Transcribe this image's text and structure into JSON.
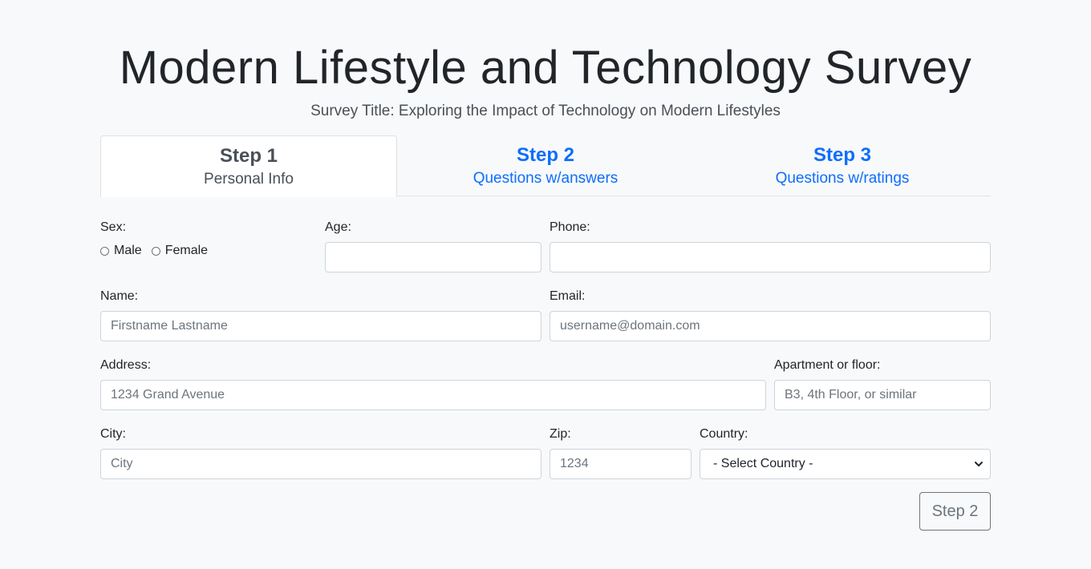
{
  "header": {
    "title": "Modern Lifestyle and Technology Survey",
    "subtitle": "Survey Title: Exploring the Impact of Technology on Modern Lifestyles"
  },
  "tabs": [
    {
      "step": "Step 1",
      "label": "Personal Info",
      "active": true
    },
    {
      "step": "Step 2",
      "label": "Questions w/answers",
      "active": false
    },
    {
      "step": "Step 3",
      "label": "Questions w/ratings",
      "active": false
    }
  ],
  "form": {
    "sex": {
      "label": "Sex:",
      "options": [
        "Male",
        "Female"
      ]
    },
    "age": {
      "label": "Age:",
      "value": "",
      "placeholder": ""
    },
    "phone": {
      "label": "Phone:",
      "value": "",
      "placeholder": ""
    },
    "name": {
      "label": "Name:",
      "placeholder": "Firstname Lastname"
    },
    "email": {
      "label": "Email:",
      "placeholder": "username@domain.com"
    },
    "address": {
      "label": "Address:",
      "placeholder": "1234 Grand Avenue"
    },
    "apartment": {
      "label": "Apartment or floor:",
      "placeholder": "B3, 4th Floor, or similar"
    },
    "city": {
      "label": "City:",
      "placeholder": "City"
    },
    "zip": {
      "label": "Zip:",
      "placeholder": "1234"
    },
    "country": {
      "label": "Country:",
      "selected": "- Select Country -"
    }
  },
  "actions": {
    "next_label": "Step 2"
  },
  "colors": {
    "accent": "#0d6efd",
    "background": "#f8f9fa",
    "border": "#ced4da"
  }
}
